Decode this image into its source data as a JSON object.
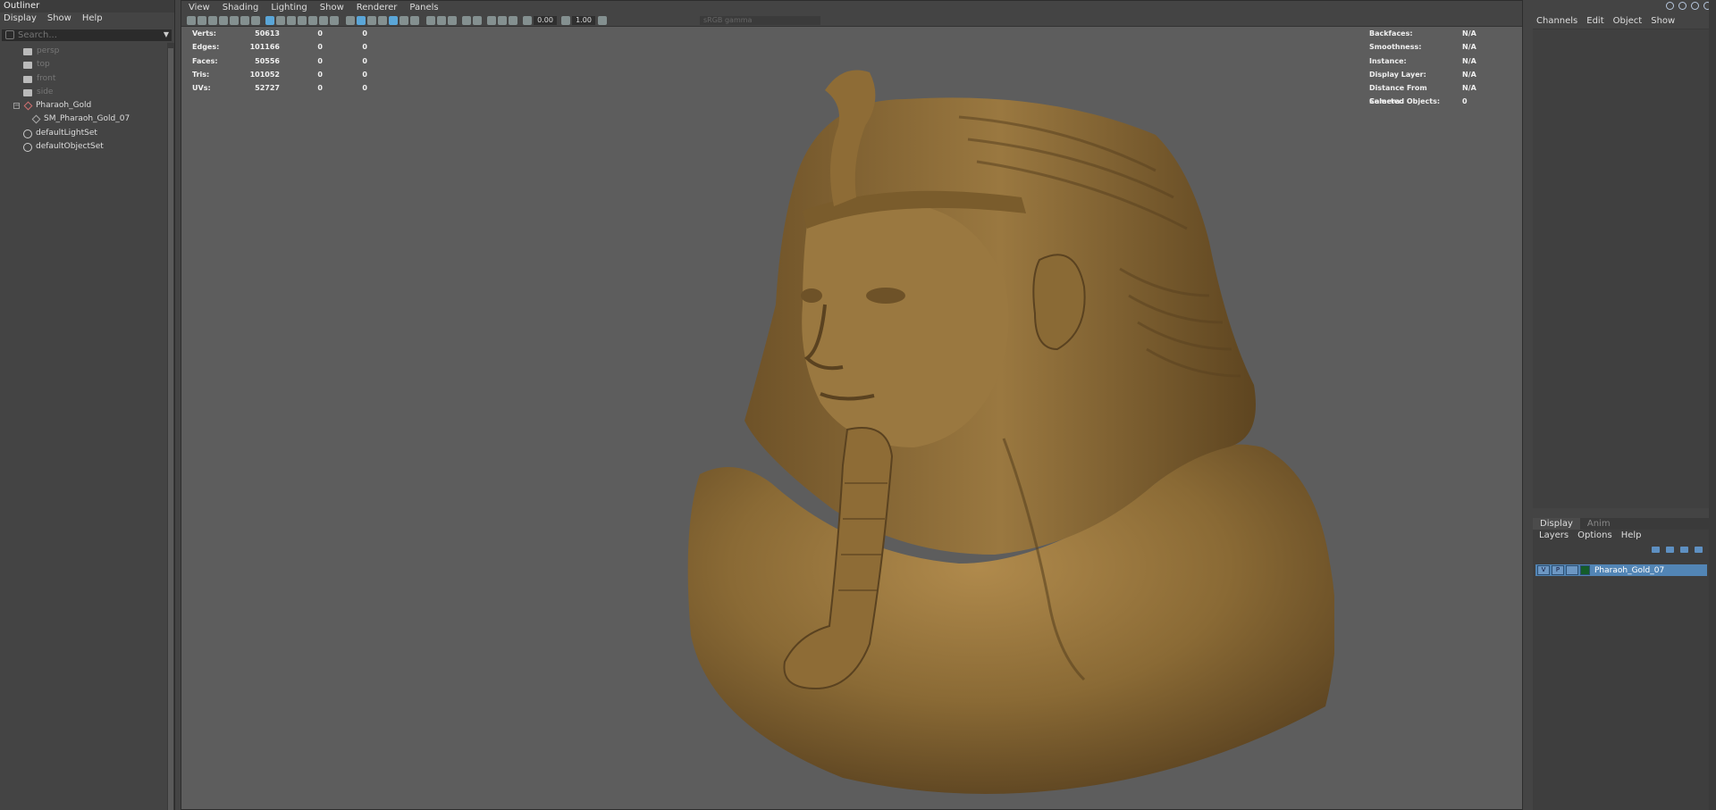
{
  "outliner": {
    "title": "Outliner",
    "menu": [
      "Display",
      "Show",
      "Help"
    ],
    "search_placeholder": "Search...",
    "items": [
      {
        "label": "persp",
        "type": "camera",
        "dim": true
      },
      {
        "label": "top",
        "type": "camera",
        "dim": true
      },
      {
        "label": "front",
        "type": "camera",
        "dim": true
      },
      {
        "label": "side",
        "type": "camera",
        "dim": true
      },
      {
        "label": "Pharaoh_Gold",
        "type": "group"
      },
      {
        "label": "SM_Pharaoh_Gold_07",
        "type": "mesh"
      },
      {
        "label": "defaultLightSet",
        "type": "set"
      },
      {
        "label": "defaultObjectSet",
        "type": "set"
      }
    ]
  },
  "viewport": {
    "menu": [
      "View",
      "Shading",
      "Lighting",
      "Show",
      "Renderer",
      "Panels"
    ],
    "toolbar": {
      "exposure": "0.00",
      "gamma": "1.00",
      "color_space": "sRGB gamma"
    },
    "hud_stats": [
      {
        "label": "Verts:",
        "value": "50613",
        "sel": "0",
        "comp": "0"
      },
      {
        "label": "Edges:",
        "value": "101166",
        "sel": "0",
        "comp": "0"
      },
      {
        "label": "Faces:",
        "value": "50556",
        "sel": "0",
        "comp": "0"
      },
      {
        "label": "Tris:",
        "value": "101052",
        "sel": "0",
        "comp": "0"
      },
      {
        "label": "UVs:",
        "value": "52727",
        "sel": "0",
        "comp": "0"
      }
    ],
    "hud_info": [
      {
        "label": "Backfaces:",
        "value": "N/A"
      },
      {
        "label": "Smoothness:",
        "value": "N/A"
      },
      {
        "label": "Instance:",
        "value": "N/A"
      },
      {
        "label": "Display Layer:",
        "value": "N/A"
      },
      {
        "label": "Distance From Camera:",
        "value": "N/A"
      },
      {
        "label": "Selected Objects:",
        "value": "0"
      }
    ]
  },
  "channel_box": {
    "menu": [
      "Channels",
      "Edit",
      "Object",
      "Show"
    ]
  },
  "layer_editor": {
    "tabs": [
      "Display",
      "Anim"
    ],
    "menu": [
      "Layers",
      "Options",
      "Help"
    ],
    "layer": {
      "visible": "V",
      "playback": "P",
      "name": "Pharaoh_Gold_07"
    }
  },
  "colors": {
    "accent": "#5285b5",
    "viewport_bg": "#5d5d5d",
    "model": "#8a6a35"
  }
}
